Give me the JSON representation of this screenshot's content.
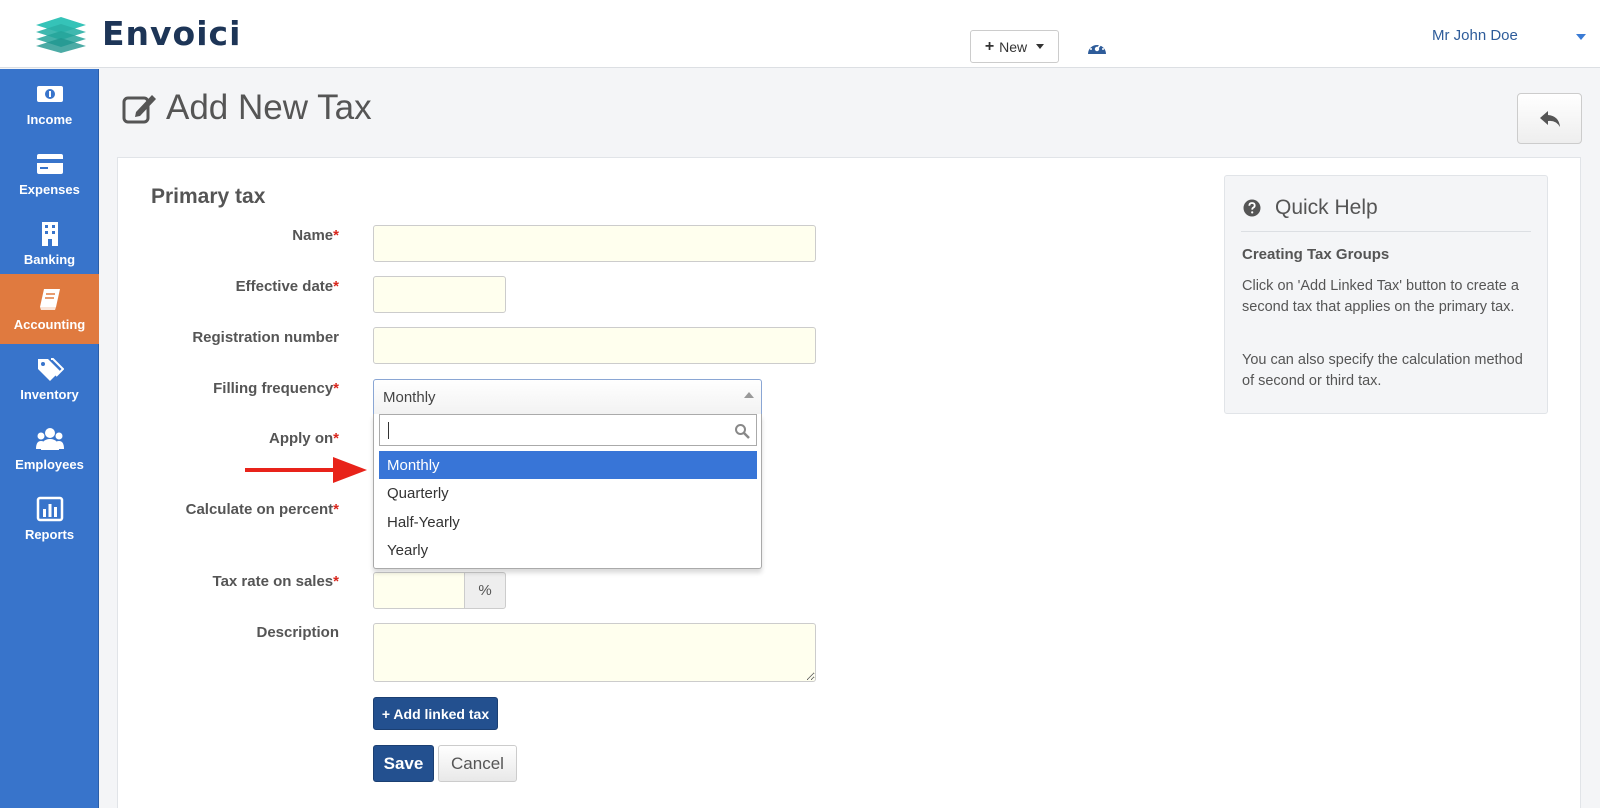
{
  "app": {
    "brand": "Envoici"
  },
  "topbar": {
    "new_label": "New",
    "user_name": "Mr John Doe"
  },
  "sidebar": {
    "items": [
      {
        "label": "Income",
        "icon": "money-icon"
      },
      {
        "label": "Expenses",
        "icon": "credit-card-icon"
      },
      {
        "label": "Banking",
        "icon": "building-icon"
      },
      {
        "label": "Accounting",
        "icon": "book-icon",
        "active": true
      },
      {
        "label": "Inventory",
        "icon": "tags-icon"
      },
      {
        "label": "Employees",
        "icon": "users-icon"
      },
      {
        "label": "Reports",
        "icon": "bar-chart-icon"
      }
    ]
  },
  "page": {
    "title": "Add New Tax"
  },
  "form": {
    "section_title": "Primary tax",
    "required_mark": "*",
    "fields": {
      "name": {
        "label": "Name",
        "value": ""
      },
      "effective_date": {
        "label": "Effective date",
        "value": ""
      },
      "registration_number": {
        "label": "Registration number",
        "value": ""
      },
      "filling_frequency": {
        "label": "Filling frequency",
        "value": "Monthly",
        "search_value": "",
        "options": [
          "Monthly",
          "Quarterly",
          "Half-Yearly",
          "Yearly"
        ],
        "highlighted": "Monthly"
      },
      "apply_on": {
        "label": "Apply on"
      },
      "calculate_on_percent": {
        "label": "Calculate on percent"
      },
      "tax_rate_on_sales": {
        "label": "Tax rate on sales",
        "value": "",
        "unit": "%"
      },
      "description": {
        "label": "Description",
        "value": ""
      }
    },
    "add_linked_tax_label": "+ Add linked tax",
    "save_label": "Save",
    "cancel_label": "Cancel"
  },
  "help": {
    "title": "Quick Help",
    "subtitle": "Creating Tax Groups",
    "paragraphs": [
      "Click on 'Add Linked Tax' button to create a second tax that applies on the primary tax.",
      "You can also specify the calculation method of second or third tax."
    ]
  },
  "colors": {
    "sidebar": "#3874cb",
    "sidebar_active": "#e07a3f",
    "primary_button": "#23508f",
    "input_bg": "#ffffee",
    "required": "#d9261c",
    "highlight": "#3875d7",
    "annotation_arrow": "#e8231a"
  }
}
